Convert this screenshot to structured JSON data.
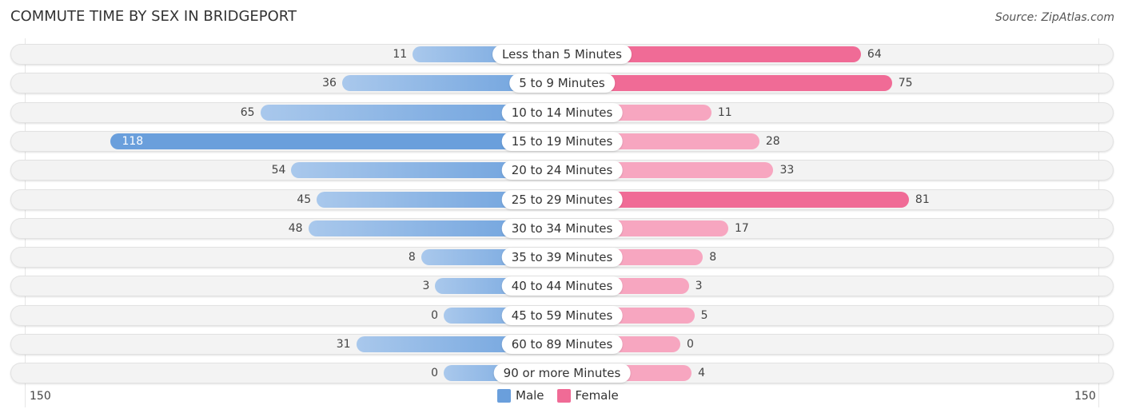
{
  "title": "COMMUTE TIME BY SEX IN BRIDGEPORT",
  "source": "Source: ZipAtlas.com",
  "colors": {
    "male": "#6a9fdc",
    "male_light": "#a9c8ec",
    "female": "#f06b96",
    "female_light": "#f7a6c0"
  },
  "chart_data": {
    "type": "bar",
    "orientation": "horizontal-diverging",
    "title": "COMMUTE TIME BY SEX IN BRIDGEPORT",
    "categories": [
      "Less than 5 Minutes",
      "5 to 9 Minutes",
      "10 to 14 Minutes",
      "15 to 19 Minutes",
      "20 to 24 Minutes",
      "25 to 29 Minutes",
      "30 to 34 Minutes",
      "35 to 39 Minutes",
      "40 to 44 Minutes",
      "45 to 59 Minutes",
      "60 to 89 Minutes",
      "90 or more Minutes"
    ],
    "series": [
      {
        "name": "Male",
        "values": [
          11,
          36,
          65,
          118,
          54,
          45,
          48,
          8,
          3,
          0,
          31,
          0
        ]
      },
      {
        "name": "Female",
        "values": [
          64,
          75,
          11,
          28,
          33,
          81,
          17,
          8,
          3,
          5,
          0,
          4
        ]
      }
    ],
    "axis": {
      "left_label": "150",
      "right_label": "150",
      "range": [
        -150,
        150
      ]
    },
    "legend": {
      "position": "bottom-center",
      "entries": [
        "Male",
        "Female"
      ]
    }
  }
}
